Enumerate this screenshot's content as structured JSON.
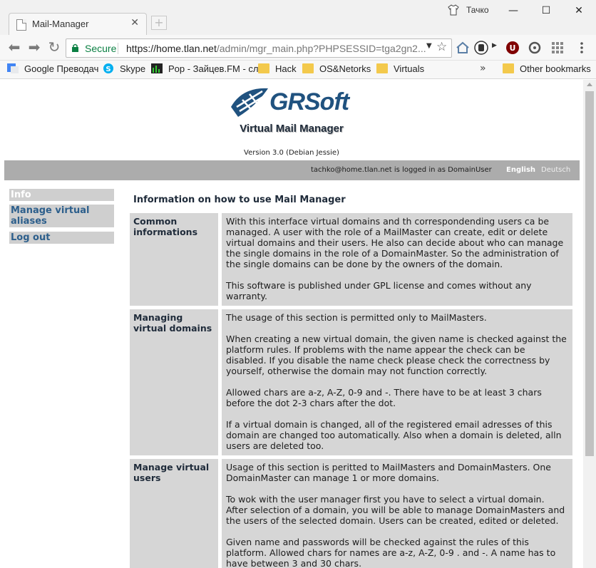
{
  "browser": {
    "tab_title": "Mail-Manager",
    "profile_name": "Тачко",
    "secure_label": "Secure",
    "url_host": "https://home.tlan.net",
    "url_path": "/admin/mgr_main.php?PHPSESSID=tga2gn2...",
    "bookmarks": [
      {
        "label": "Google Преводач"
      },
      {
        "label": "Skype"
      },
      {
        "label": "Pop - Зайцев.FM - сл"
      },
      {
        "label": "Hack"
      },
      {
        "label": "OS&Netorks"
      },
      {
        "label": "Virtuals"
      }
    ],
    "bookmarks_more": "»",
    "other_bookmarks": "Other bookmarks"
  },
  "header": {
    "logo_text": "GRSoft",
    "app_title": "Virtual Mail Manager",
    "version": "Version 3.0 (Debian Jessie)",
    "login_info": "tachko@home.tlan.net is logged in as DomainUser",
    "lang_english": "English",
    "lang_deutsch": "Deutsch"
  },
  "menu": {
    "info": "Info",
    "manage_aliases": "Manage virtual aliases",
    "logout": "Log out"
  },
  "content": {
    "title": "Information on how to use Mail Manager",
    "sections": [
      {
        "heading": "Common informations",
        "paragraphs": [
          "With this interface virtual domains and th correspondending users ca be managed. A user with the role of a MailMaster can create, edit or delete virtual domains and their users. He also can decide about who can manage the single domains in the role of a DomainMaster. So the administration of the single domains can be done by the owners of the domain.",
          "This software is published under GPL license and comes without any warranty."
        ]
      },
      {
        "heading": "Managing virtual domains",
        "paragraphs": [
          "The usage of this section is permitted only to MailMasters.",
          "When creating a new virtual domain, the given name is checked against the platform rules. If problems with the name appear the check can be disabled. If you disable the name check please check the correctness by yourself, otherwise the domain may not function correctly.",
          "Allowed chars are a-z, A-Z, 0-9 and -. There have to be at least 3 chars before the dot 2-3 chars after the dot.",
          "If a virtual domain is changed, all of the registered email adresses of this domain are changed too automatically. Also when a domain is deleted, alln users are deleted too."
        ]
      },
      {
        "heading": "Manage virtual users",
        "paragraphs": [
          "Usage of this section is peritted to MailMasters and DomainMasters. One DomainMaster can manage 1 or more domains.",
          "To wok with the user manager first you have to select a virtual domain. After selection of a domain, you will be able to manage DomainMasters and the users of the selected domain. Users can be created, edited or deleted.",
          "Given name and passwords will be checked against the rules of this platform. Allowed chars for names are a-z, A-Z, 0-9 . and -. A name has to have between 3 and 30 chars."
        ]
      }
    ]
  }
}
